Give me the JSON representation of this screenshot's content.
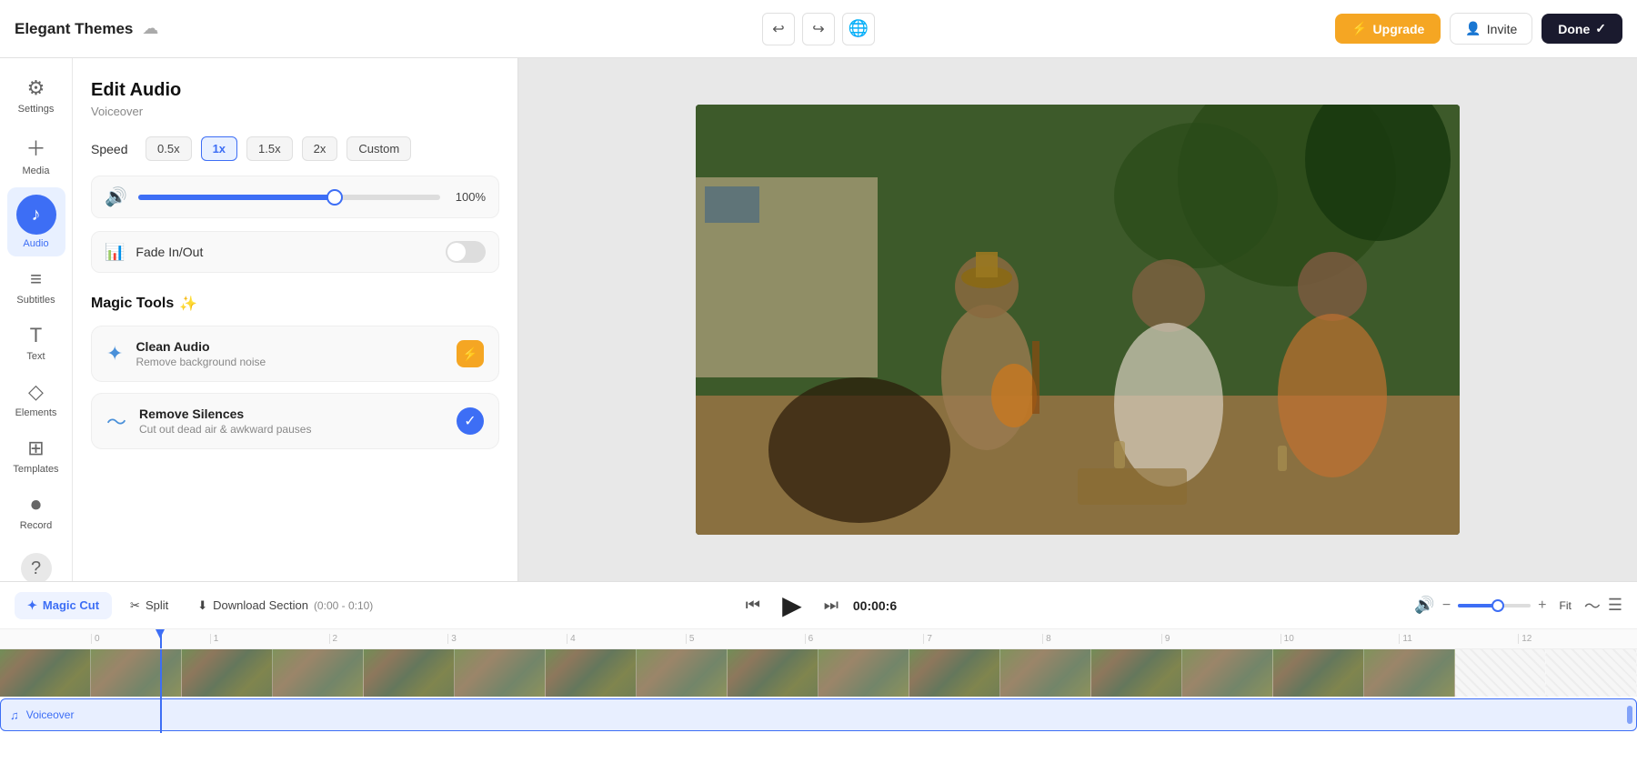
{
  "topbar": {
    "project_title": "Elegant Themes",
    "cloud_icon": "☁",
    "undo_icon": "↩",
    "redo_icon": "↪",
    "globe_icon": "🌐",
    "upgrade_label": "Upgrade",
    "upgrade_icon": "⚡",
    "invite_label": "Invite",
    "invite_icon": "👤",
    "done_label": "Done",
    "done_icon": "✓"
  },
  "icon_sidebar": {
    "items": [
      {
        "id": "settings",
        "icon": "⚙",
        "label": "Settings",
        "active": false
      },
      {
        "id": "media",
        "icon": "+",
        "label": "Media",
        "active": false
      },
      {
        "id": "audio",
        "icon": "♪",
        "label": "Audio",
        "active": true
      },
      {
        "id": "subtitles",
        "icon": "≡",
        "label": "Subtitles",
        "active": false
      },
      {
        "id": "text",
        "icon": "T",
        "label": "Text",
        "active": false
      },
      {
        "id": "elements",
        "icon": "◇",
        "label": "Elements",
        "active": false
      },
      {
        "id": "templates",
        "icon": "⊞",
        "label": "Templates",
        "active": false
      },
      {
        "id": "record",
        "icon": "⏺",
        "label": "Record",
        "active": false
      },
      {
        "id": "help",
        "icon": "?",
        "label": "",
        "active": false
      }
    ]
  },
  "edit_panel": {
    "title": "Edit Audio",
    "subtitle": "Voiceover",
    "speed_label": "Speed",
    "speed_options": [
      "0.5x",
      "1x",
      "1.5x",
      "2x",
      "Custom"
    ],
    "active_speed": "1x",
    "volume_pct": "100%",
    "volume_icon": "🔊",
    "fade_label": "Fade In/Out",
    "fade_icon": "📊",
    "fade_enabled": false,
    "magic_tools_label": "Magic Tools",
    "magic_icon": "✨",
    "tools": [
      {
        "id": "clean-audio",
        "icon": "✦",
        "title": "Clean Audio",
        "desc": "Remove background noise",
        "badge_type": "orange",
        "badge_icon": "⚡"
      },
      {
        "id": "remove-silences",
        "icon": "〜",
        "title": "Remove Silences",
        "desc": "Cut out dead air & awkward pauses",
        "badge_type": "blue",
        "badge_icon": "✓"
      }
    ]
  },
  "bottom_toolbar": {
    "magic_cut_label": "Magic Cut",
    "magic_cut_icon": "✦",
    "split_label": "Split",
    "split_icon": "✂",
    "download_label": "Download Section",
    "download_range": "(0:00 - 0:10)",
    "download_icon": "⬇",
    "timecode": "00:00:6",
    "skip_back_icon": "⏮",
    "skip_fwd_icon": "⏭",
    "play_icon": "▶",
    "volume_icon": "🔊",
    "zoom_minus": "−",
    "zoom_plus": "+",
    "fit_label": "Fit",
    "waveform_icon": "〜",
    "settings_icon": "☰"
  },
  "timeline": {
    "ruler_marks": [
      "0",
      "1",
      "2",
      "3",
      "4",
      "5",
      "6",
      "7",
      "8",
      "9",
      "10",
      "11",
      "12"
    ],
    "audio_track_label": "Voiceover",
    "audio_track_icon": "♪"
  },
  "colors": {
    "accent_blue": "#3d6ef5",
    "accent_orange": "#f5a623",
    "done_bg": "#1a1a2e"
  }
}
